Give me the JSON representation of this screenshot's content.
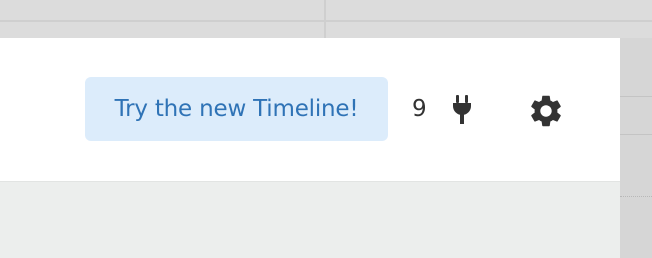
{
  "header": {
    "timeline_promo_label": "Try the new Timeline!",
    "plugin_count": "9"
  },
  "icons": {
    "plugin": "plug-icon",
    "settings": "gear-icon"
  },
  "colors": {
    "promo_bg": "#dcecfb",
    "promo_text": "#2f73b6",
    "icon": "#333333",
    "panel_bg": "#eceeed",
    "topbar_bg": "#ffffff"
  }
}
